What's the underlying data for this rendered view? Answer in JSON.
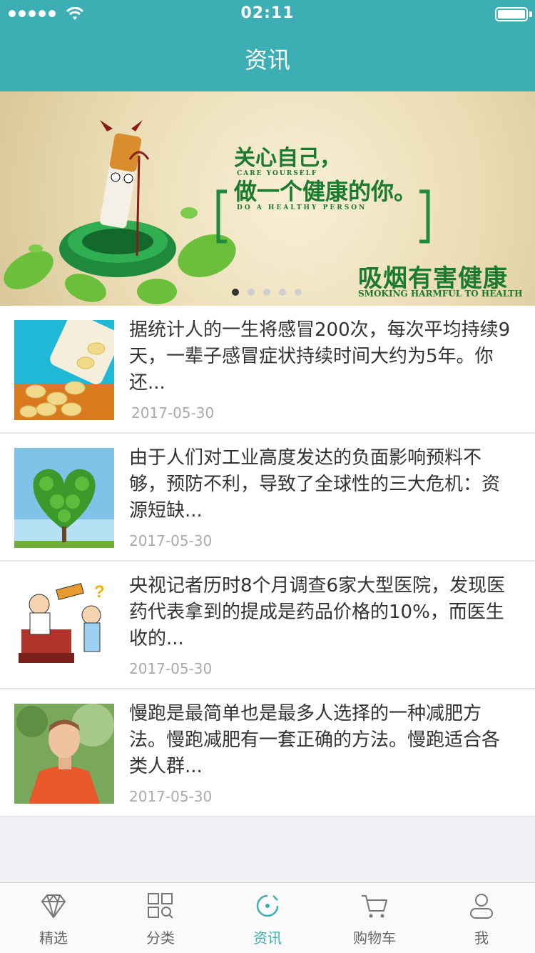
{
  "status": {
    "time": "02:11"
  },
  "header": {
    "title": "资讯"
  },
  "banner": {
    "slogan_line1": "关心自己，",
    "slogan_sub1": "CARE YOURSELF",
    "slogan_line2": "做一个健康的你。",
    "slogan_sub2": "DO A HEALTHY PERSON",
    "warning": "吸烟有害健康",
    "warning_en": "SMOKING HARMFUL TO HEALTH",
    "active_dot": 1,
    "dot_count": 5
  },
  "articles": [
    {
      "title": "据统计人的一生将感冒200次，每次平均持续9天，一辈子感冒症状持续时间大约为5年。你还...",
      "date": "2017-05-30",
      "thumb_icon": "pills-thumbnail"
    },
    {
      "title": "由于人们对工业高度发达的负面影响预料不够，预防不利，导致了全球性的三大危机：资源短缺...",
      "date": "2017-05-30",
      "thumb_icon": "heart-tree-thumbnail"
    },
    {
      "title": "央视记者历时8个月调查6家大型医院，发现医药代表拿到的提成是药品价格的10%，而医生收的...",
      "date": "2017-05-30",
      "thumb_icon": "cartoon-doctor-thumbnail"
    },
    {
      "title": "慢跑是最简单也是最多人选择的一种减肥方法。慢跑减肥有一套正确的方法。慢跑适合各类人群...",
      "date": "2017-05-30",
      "thumb_icon": "runner-thumbnail"
    }
  ],
  "tabs": [
    {
      "label": "精选",
      "icon": "diamond-icon",
      "active": false
    },
    {
      "label": "分类",
      "icon": "category-search-icon",
      "active": false
    },
    {
      "label": "资讯",
      "icon": "news-icon",
      "active": true
    },
    {
      "label": "购物车",
      "icon": "cart-icon",
      "active": false
    },
    {
      "label": "我",
      "icon": "person-icon",
      "active": false
    }
  ],
  "colors": {
    "brand": "#3eaeb5",
    "text": "#333333",
    "muted": "#aaaaaa"
  }
}
